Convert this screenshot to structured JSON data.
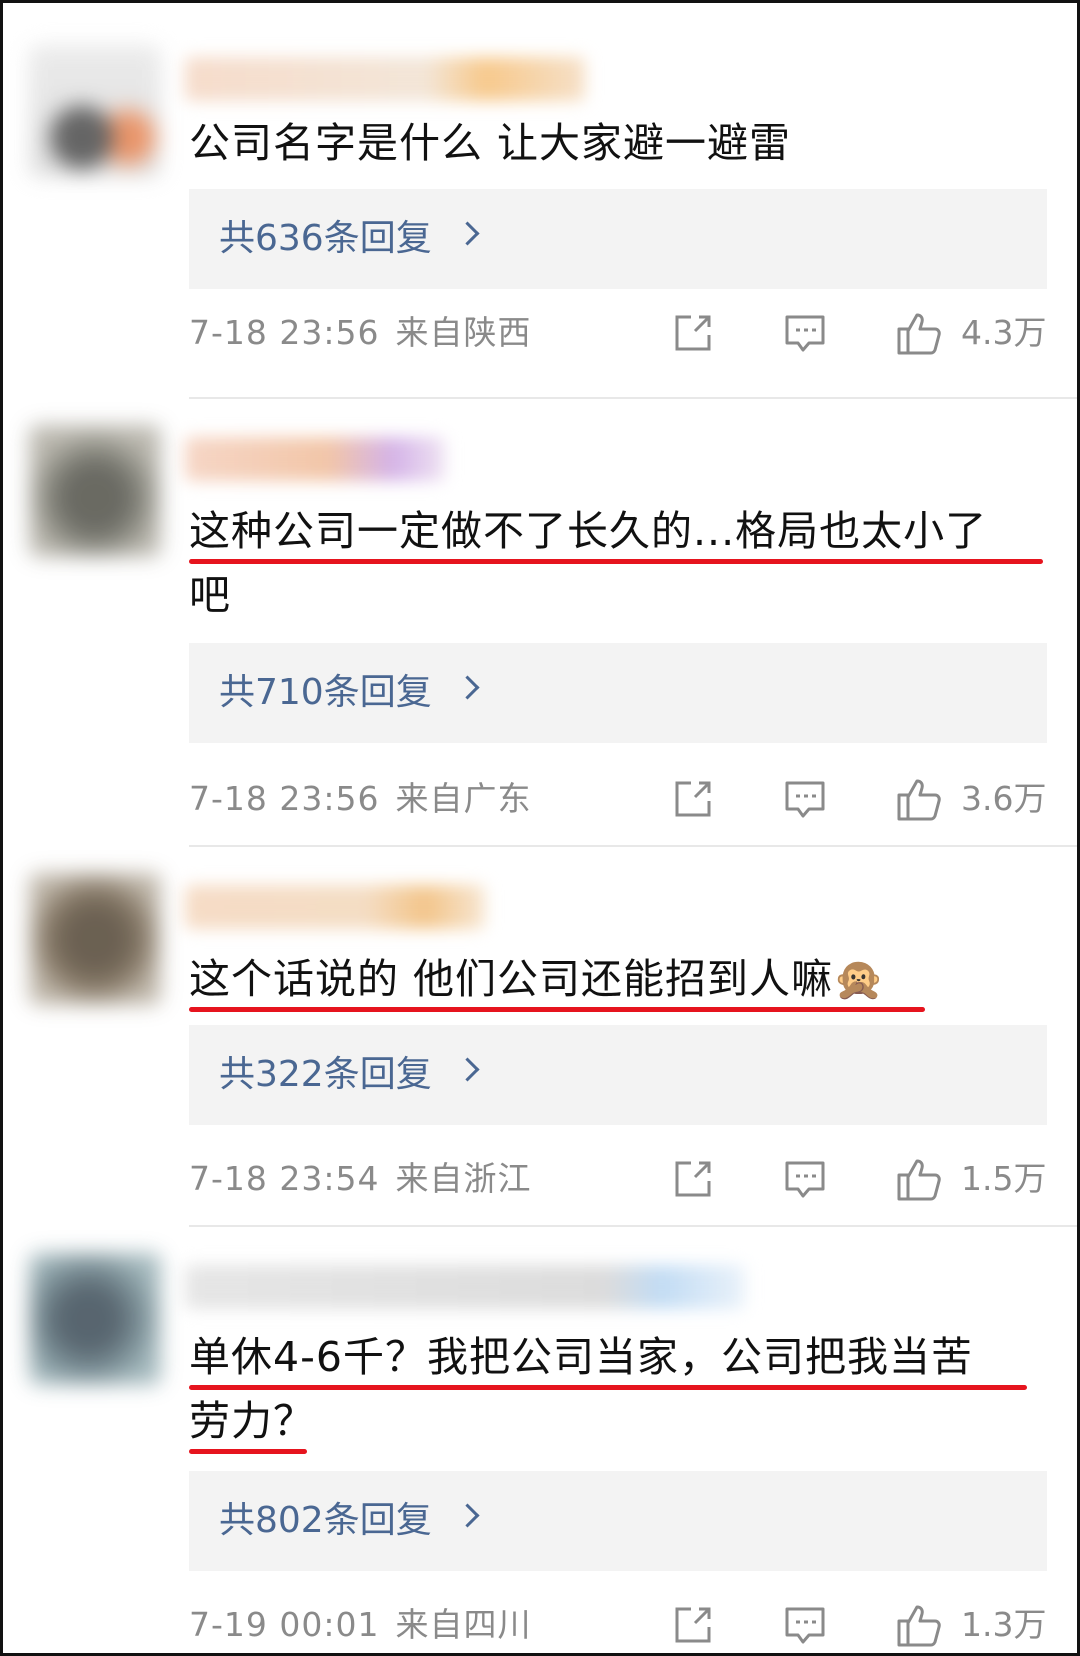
{
  "comments": [
    {
      "text": "公司名字是什么 让大家避一避雷",
      "replies": "共636条回复",
      "time": "7-18 23:56",
      "location": "来自陕西",
      "likes": "4.3万",
      "underlined": false
    },
    {
      "text_line1": "这种公司一定做不了长久的...格局也太小了",
      "text_line2": "吧",
      "replies": "共710条回复",
      "time": "7-18 23:56",
      "location": "来自广东",
      "likes": "3.6万",
      "underlined": true
    },
    {
      "text": "这个话说的 他们公司还能招到人嘛🙊",
      "replies": "共322条回复",
      "time": "7-18 23:54",
      "location": "来自浙江",
      "likes": "1.5万",
      "underlined": true
    },
    {
      "text_line1": "单休4-6千？我把公司当家，公司把我当苦",
      "text_line2": "劳力？",
      "replies": "共802条回复",
      "time": "7-19 00:01",
      "location": "来自四川",
      "likes": "1.3万",
      "underlined": true
    }
  ],
  "colors": {
    "reply_link": "#4a6792",
    "underline": "#e6141e",
    "meta": "#8a8a8a",
    "reply_bg": "#f3f3f3"
  },
  "icons": [
    "share-icon",
    "comment-icon",
    "thumbs-up-icon"
  ]
}
